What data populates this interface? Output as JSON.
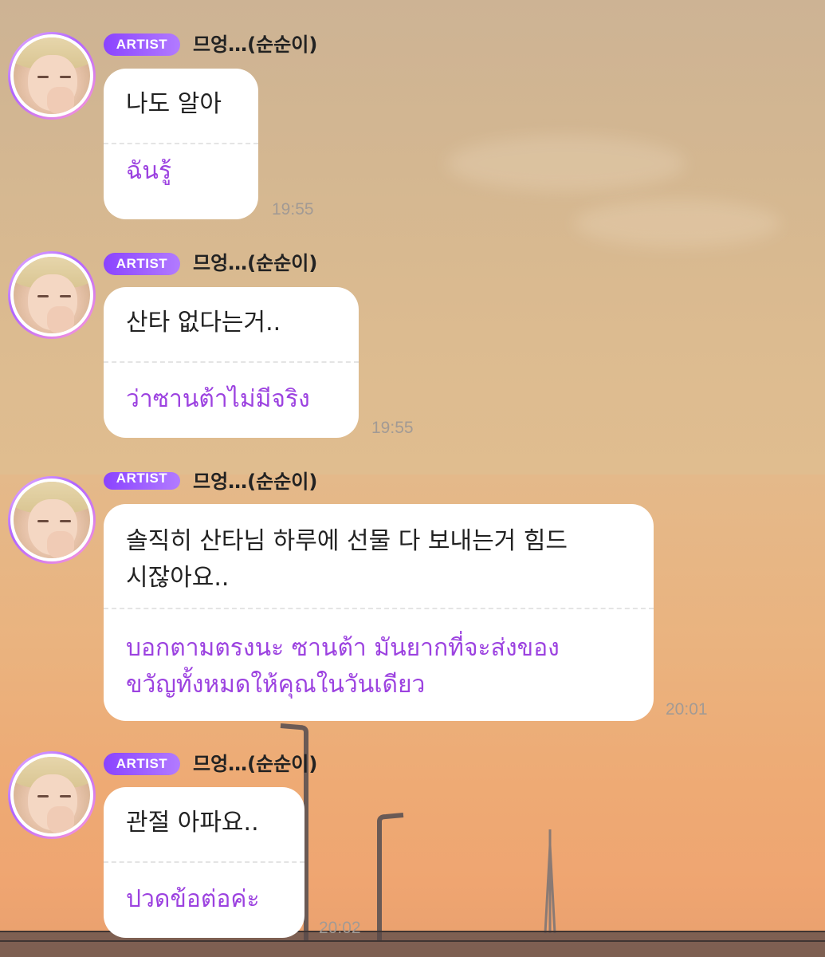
{
  "messages": [
    {
      "badge": "ARTIST",
      "name": "므엉…(순순이)",
      "original": "나도 알아",
      "translation": "ฉันรู้",
      "time": "19:55"
    },
    {
      "badge": "ARTIST",
      "name": "므엉…(순순이)",
      "original": "산타 없다는거..",
      "translation": "ว่าซานต้าไม่มีจริง",
      "time": "19:55"
    },
    {
      "badge": "ARTIST",
      "name": "므엉…(순순이)",
      "original_lines": [
        "솔직히 산타님 하루에 선물 다 보내는거 힘드",
        "시잖아요.."
      ],
      "translation_lines": [
        "บอกตามตรงนะ ซานต้า มันยากที่จะส่งของ",
        "ขวัญทั้งหมดให้คุณในวันเดียว"
      ],
      "time": "20:01"
    },
    {
      "badge": "ARTIST",
      "name": "므엉…(순순이)",
      "original": "관절 아파요..",
      "translation": "ปวดข้อต่อค่ะ",
      "time": "20:02"
    }
  ],
  "colors": {
    "badge_start": "#8a43ff",
    "badge_end": "#b27bff",
    "translation_text": "#9c42e0",
    "bubble": "#ffffff"
  },
  "icons": {
    "avatar": "artist-avatar-photo"
  }
}
